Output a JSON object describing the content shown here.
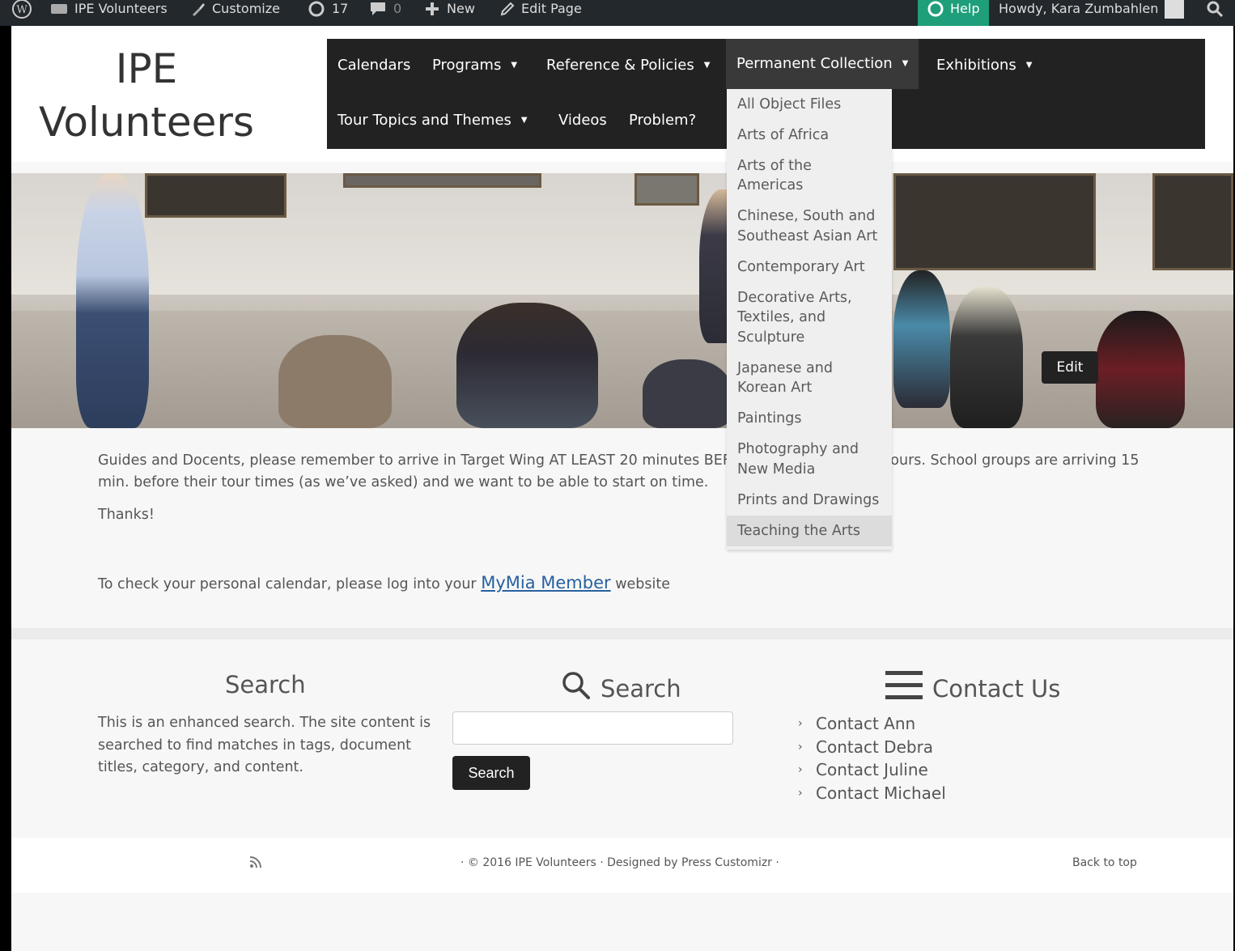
{
  "admin_bar": {
    "site_name": "IPE Volunteers",
    "customize": "Customize",
    "updates_count": "17",
    "comments_count": "0",
    "new_label": "New",
    "edit_page": "Edit Page",
    "help": "Help",
    "howdy": "Howdy, Kara Zumbahlen"
  },
  "site": {
    "title_line1": "IPE",
    "title_line2": "Volunteers"
  },
  "nav": {
    "row1": [
      {
        "label": "Calendars",
        "has_caret": false
      },
      {
        "label": "Programs",
        "has_caret": true
      },
      {
        "label": "Reference & Policies",
        "has_caret": true
      },
      {
        "label": "Permanent Collection",
        "has_caret": true,
        "active": true
      },
      {
        "label": "Exhibitions",
        "has_caret": true
      }
    ],
    "row2": [
      {
        "label": "Tour Topics and Themes",
        "has_caret": true
      },
      {
        "label": "Videos",
        "has_caret": false
      },
      {
        "label": "Problem?",
        "has_caret": false
      }
    ],
    "caret": "▼"
  },
  "dropdown": {
    "items": [
      "All Object Files",
      "Arts of Africa",
      "Arts of the Americas",
      "Chinese, South and Southeast Asian Art",
      "Contemporary Art",
      "Decorative Arts, Textiles, and Sculpture",
      "Japanese and Korean Art",
      "Paintings",
      "Photography and New Media",
      "Prints and Drawings",
      "Teaching the Arts"
    ],
    "hovered": "Teaching the Arts"
  },
  "hero": {
    "edit_label": "Edit"
  },
  "content": {
    "notice": "Guides and Docents, please remember to arrive in Target Wing AT LEAST 20 minutes BEFORE the start of your tours. School groups are arriving 15 min. before their tour times (as we’ve asked) and we want to be able to start on time.",
    "thanks": "Thanks!",
    "calendar_prefix": "To check your personal calendar, please log into your ",
    "calendar_link": "MyMia Member",
    "calendar_suffix": " website"
  },
  "footer": {
    "search_title": "Search",
    "search_desc": "This is an enhanced search. The site content is searched to find matches in tags, document titles, category, and content.",
    "search_widget_title": "Search",
    "search_button": "Search",
    "contact_title": "Contact Us",
    "contacts": [
      "Contact Ann",
      "Contact Debra",
      "Contact Juline",
      "Contact Michael"
    ],
    "credits": "· © 2016 IPE Volunteers · Designed by Press Customizr ·",
    "back_to_top": "Back to top"
  },
  "colors": {
    "nav_bg": "#222222",
    "admin_bg": "#23282d",
    "help_bg": "#1e9e7a",
    "link": "#27609f"
  }
}
